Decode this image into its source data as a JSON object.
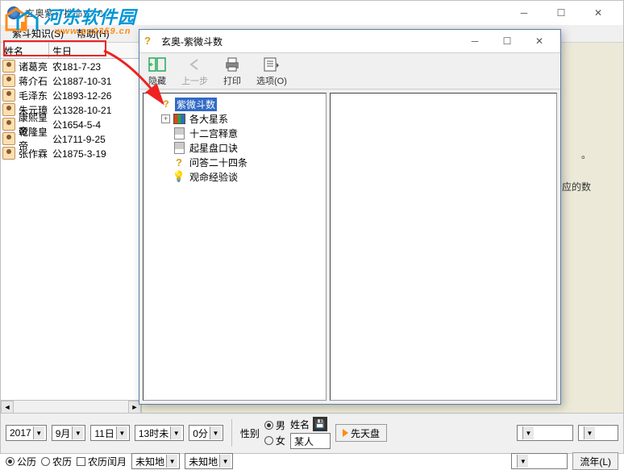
{
  "watermark": {
    "cn": "河东软件园",
    "en": "www.pc0359.cn"
  },
  "main": {
    "title": "玄奥紫斗推命V3.2",
    "menu": {
      "knowledge": "紫斗知识(S)",
      "help": "帮助(H)"
    },
    "columns": {
      "name": "姓名",
      "dob": "生日"
    },
    "rows": [
      {
        "name": "诸葛亮",
        "dob": "农181-7-23"
      },
      {
        "name": "蒋介石",
        "dob": "公1887-10-31"
      },
      {
        "name": "毛泽东",
        "dob": "公1893-12-26"
      },
      {
        "name": "朱元璋",
        "dob": "公1328-10-21"
      },
      {
        "name": "康熙皇帝",
        "dob": "公1654-5-4"
      },
      {
        "name": "乾隆皇帝",
        "dob": "公1711-9-25"
      },
      {
        "name": "张作霖",
        "dob": "公1875-3-19"
      }
    ],
    "right_hint1": "。",
    "right_hint2": "应的数"
  },
  "child": {
    "title": "玄奥-紫微斗数",
    "toolbar": {
      "hide": "隐藏",
      "back": "上一步",
      "print": "打印",
      "options": "选项(O)"
    },
    "tree": [
      {
        "label": "紫微斗数",
        "icon": "help",
        "selected": true,
        "exp": ""
      },
      {
        "label": "各大星系",
        "icon": "books",
        "exp": "+"
      },
      {
        "label": "十二宫释意",
        "icon": "page",
        "exp": ""
      },
      {
        "label": "起星盘口诀",
        "icon": "page",
        "exp": ""
      },
      {
        "label": "问答二十四条",
        "icon": "qm",
        "exp": ""
      },
      {
        "label": "观命经验谈",
        "icon": "bulb",
        "exp": ""
      }
    ]
  },
  "bottom": {
    "year": "2017",
    "month": "9月",
    "day": "11日",
    "hour": "13时未",
    "minute": "0分",
    "cal_solar": "公历",
    "cal_lunar": "农历",
    "cal_leap": "农历闰月",
    "place1": "未知地",
    "place2": "未知地",
    "gender_label": "性别",
    "male": "男",
    "female": "女",
    "name_label": "姓名",
    "name_value": "某人",
    "btn_chart": "先天盘",
    "btn_year": "流年(L)"
  }
}
